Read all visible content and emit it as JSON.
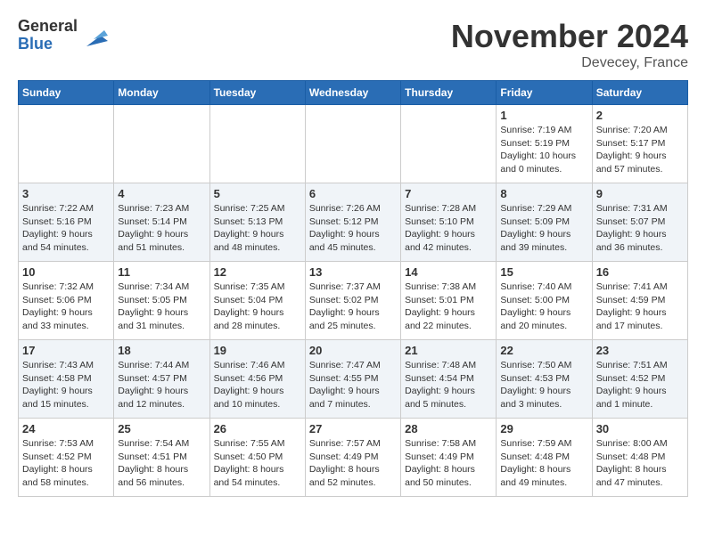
{
  "header": {
    "logo_general": "General",
    "logo_blue": "Blue",
    "month": "November 2024",
    "location": "Devecey, France"
  },
  "days_of_week": [
    "Sunday",
    "Monday",
    "Tuesday",
    "Wednesday",
    "Thursday",
    "Friday",
    "Saturday"
  ],
  "weeks": [
    [
      {
        "day": "",
        "info": ""
      },
      {
        "day": "",
        "info": ""
      },
      {
        "day": "",
        "info": ""
      },
      {
        "day": "",
        "info": ""
      },
      {
        "day": "",
        "info": ""
      },
      {
        "day": "1",
        "info": "Sunrise: 7:19 AM\nSunset: 5:19 PM\nDaylight: 10 hours\nand 0 minutes."
      },
      {
        "day": "2",
        "info": "Sunrise: 7:20 AM\nSunset: 5:17 PM\nDaylight: 9 hours\nand 57 minutes."
      }
    ],
    [
      {
        "day": "3",
        "info": "Sunrise: 7:22 AM\nSunset: 5:16 PM\nDaylight: 9 hours\nand 54 minutes."
      },
      {
        "day": "4",
        "info": "Sunrise: 7:23 AM\nSunset: 5:14 PM\nDaylight: 9 hours\nand 51 minutes."
      },
      {
        "day": "5",
        "info": "Sunrise: 7:25 AM\nSunset: 5:13 PM\nDaylight: 9 hours\nand 48 minutes."
      },
      {
        "day": "6",
        "info": "Sunrise: 7:26 AM\nSunset: 5:12 PM\nDaylight: 9 hours\nand 45 minutes."
      },
      {
        "day": "7",
        "info": "Sunrise: 7:28 AM\nSunset: 5:10 PM\nDaylight: 9 hours\nand 42 minutes."
      },
      {
        "day": "8",
        "info": "Sunrise: 7:29 AM\nSunset: 5:09 PM\nDaylight: 9 hours\nand 39 minutes."
      },
      {
        "day": "9",
        "info": "Sunrise: 7:31 AM\nSunset: 5:07 PM\nDaylight: 9 hours\nand 36 minutes."
      }
    ],
    [
      {
        "day": "10",
        "info": "Sunrise: 7:32 AM\nSunset: 5:06 PM\nDaylight: 9 hours\nand 33 minutes."
      },
      {
        "day": "11",
        "info": "Sunrise: 7:34 AM\nSunset: 5:05 PM\nDaylight: 9 hours\nand 31 minutes."
      },
      {
        "day": "12",
        "info": "Sunrise: 7:35 AM\nSunset: 5:04 PM\nDaylight: 9 hours\nand 28 minutes."
      },
      {
        "day": "13",
        "info": "Sunrise: 7:37 AM\nSunset: 5:02 PM\nDaylight: 9 hours\nand 25 minutes."
      },
      {
        "day": "14",
        "info": "Sunrise: 7:38 AM\nSunset: 5:01 PM\nDaylight: 9 hours\nand 22 minutes."
      },
      {
        "day": "15",
        "info": "Sunrise: 7:40 AM\nSunset: 5:00 PM\nDaylight: 9 hours\nand 20 minutes."
      },
      {
        "day": "16",
        "info": "Sunrise: 7:41 AM\nSunset: 4:59 PM\nDaylight: 9 hours\nand 17 minutes."
      }
    ],
    [
      {
        "day": "17",
        "info": "Sunrise: 7:43 AM\nSunset: 4:58 PM\nDaylight: 9 hours\nand 15 minutes."
      },
      {
        "day": "18",
        "info": "Sunrise: 7:44 AM\nSunset: 4:57 PM\nDaylight: 9 hours\nand 12 minutes."
      },
      {
        "day": "19",
        "info": "Sunrise: 7:46 AM\nSunset: 4:56 PM\nDaylight: 9 hours\nand 10 minutes."
      },
      {
        "day": "20",
        "info": "Sunrise: 7:47 AM\nSunset: 4:55 PM\nDaylight: 9 hours\nand 7 minutes."
      },
      {
        "day": "21",
        "info": "Sunrise: 7:48 AM\nSunset: 4:54 PM\nDaylight: 9 hours\nand 5 minutes."
      },
      {
        "day": "22",
        "info": "Sunrise: 7:50 AM\nSunset: 4:53 PM\nDaylight: 9 hours\nand 3 minutes."
      },
      {
        "day": "23",
        "info": "Sunrise: 7:51 AM\nSunset: 4:52 PM\nDaylight: 9 hours\nand 1 minute."
      }
    ],
    [
      {
        "day": "24",
        "info": "Sunrise: 7:53 AM\nSunset: 4:52 PM\nDaylight: 8 hours\nand 58 minutes."
      },
      {
        "day": "25",
        "info": "Sunrise: 7:54 AM\nSunset: 4:51 PM\nDaylight: 8 hours\nand 56 minutes."
      },
      {
        "day": "26",
        "info": "Sunrise: 7:55 AM\nSunset: 4:50 PM\nDaylight: 8 hours\nand 54 minutes."
      },
      {
        "day": "27",
        "info": "Sunrise: 7:57 AM\nSunset: 4:49 PM\nDaylight: 8 hours\nand 52 minutes."
      },
      {
        "day": "28",
        "info": "Sunrise: 7:58 AM\nSunset: 4:49 PM\nDaylight: 8 hours\nand 50 minutes."
      },
      {
        "day": "29",
        "info": "Sunrise: 7:59 AM\nSunset: 4:48 PM\nDaylight: 8 hours\nand 49 minutes."
      },
      {
        "day": "30",
        "info": "Sunrise: 8:00 AM\nSunset: 4:48 PM\nDaylight: 8 hours\nand 47 minutes."
      }
    ]
  ]
}
